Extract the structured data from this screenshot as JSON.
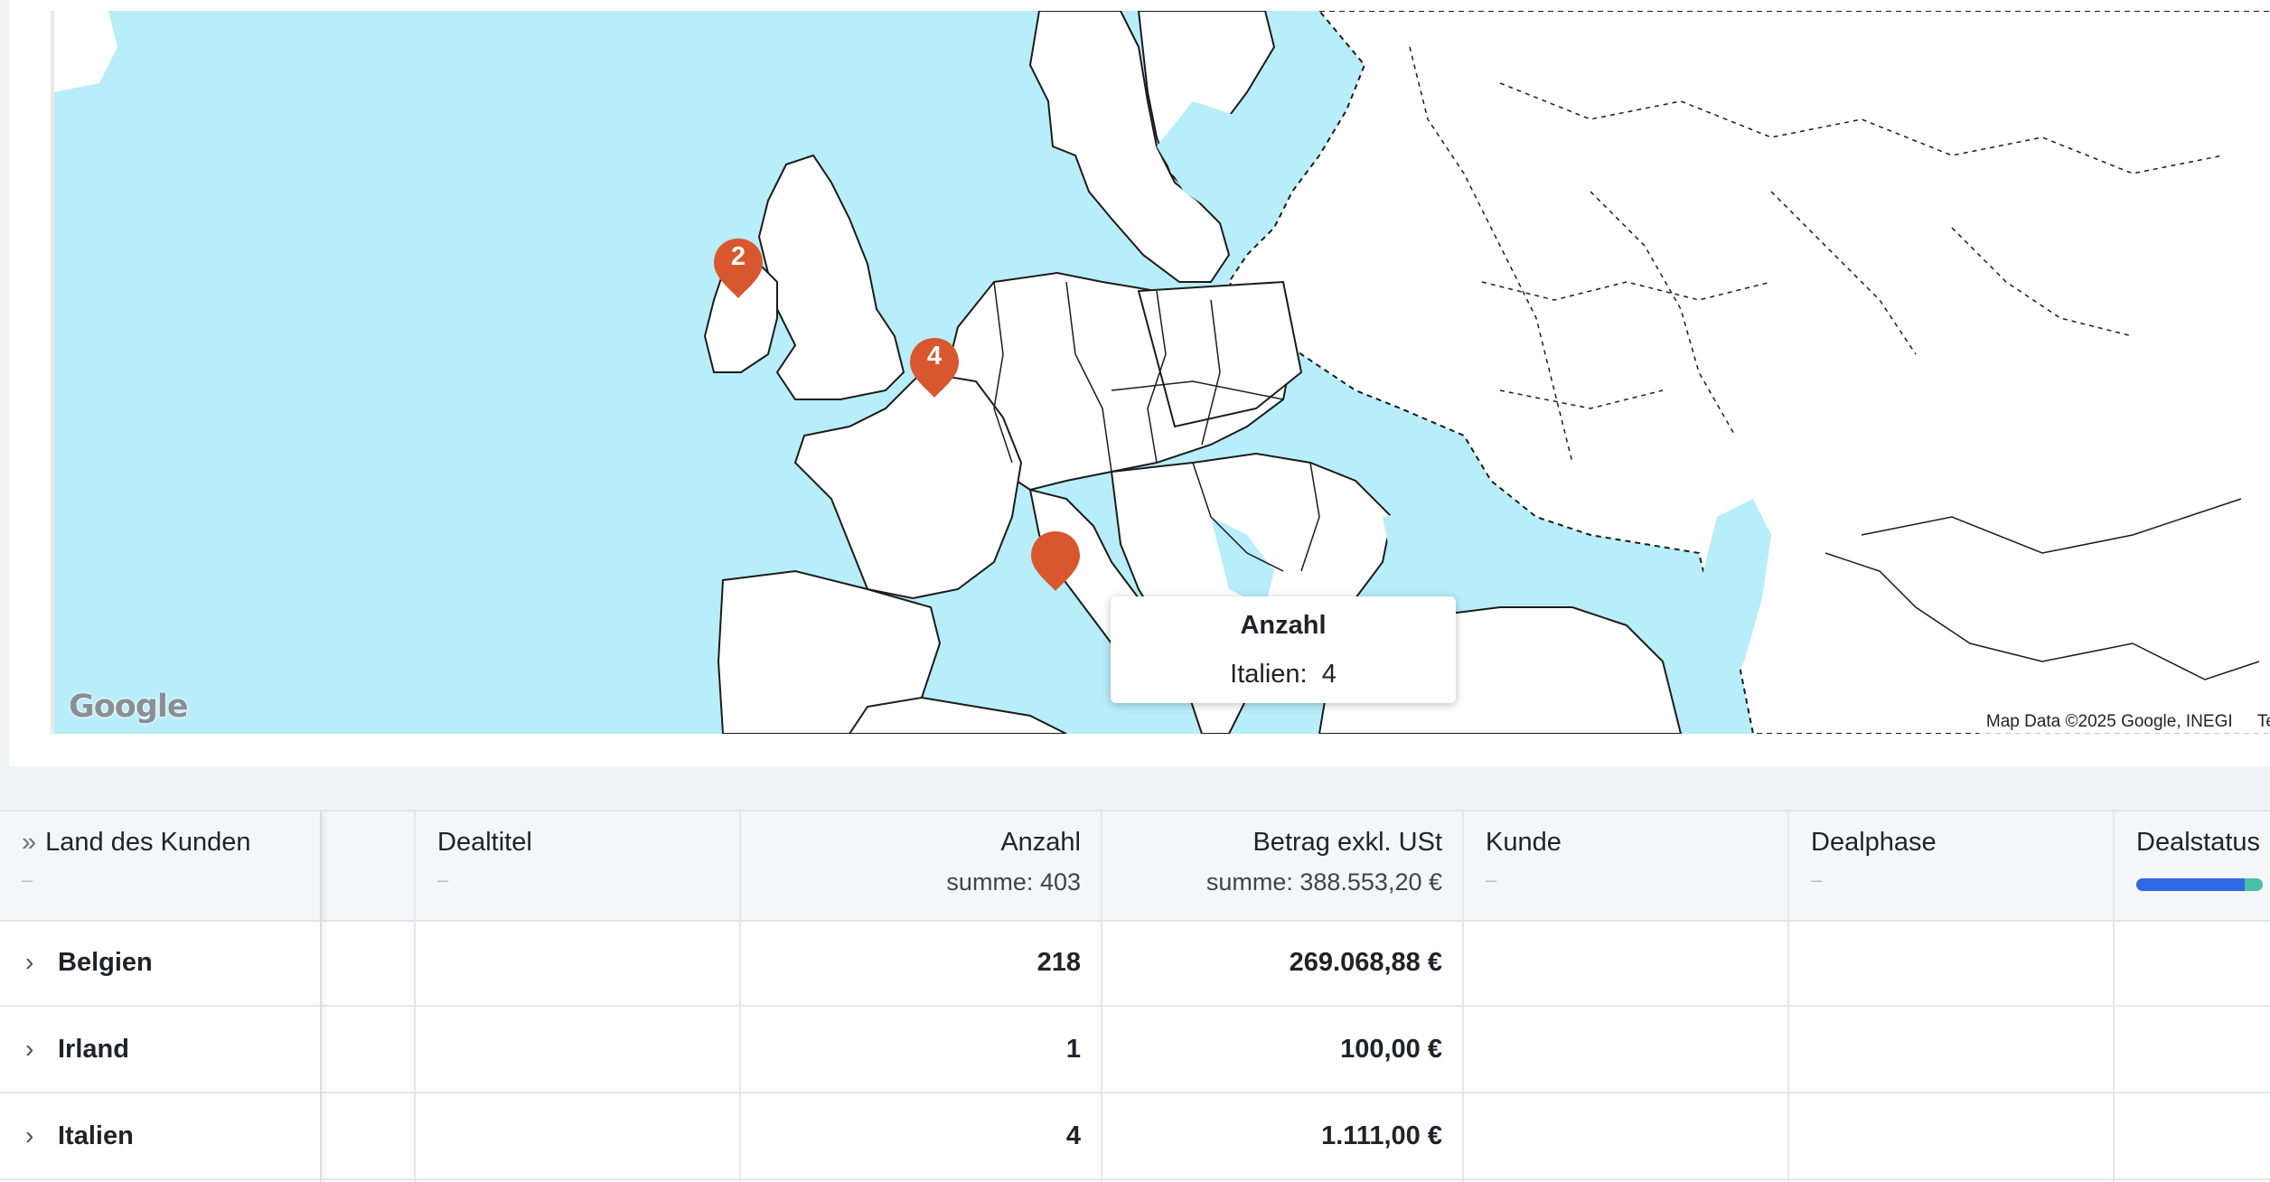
{
  "map": {
    "logo": "Google",
    "attribution": "Map Data ©2025 Google, INEGI",
    "attribution_more": "Te",
    "markers": [
      {
        "country": "Irland",
        "label": "2"
      },
      {
        "country": "Belgien",
        "label": "4"
      },
      {
        "country": "Italien",
        "label": ""
      }
    ],
    "tooltip": {
      "title": "Anzahl",
      "label": "Italien:",
      "value": "4"
    },
    "colors": {
      "water": "#b8edfa",
      "land": "#ffffff",
      "marker": "#d9572f"
    }
  },
  "table": {
    "columns": [
      {
        "label": "Land des Kunden",
        "sub": "–"
      },
      {
        "label": "",
        "sub": ""
      },
      {
        "label": "Dealtitel",
        "sub": "–"
      },
      {
        "label": "Anzahl",
        "sub": "summe: 403"
      },
      {
        "label": "Betrag exkl. USt",
        "sub": "summe: 388.553,20 €"
      },
      {
        "label": "Kunde",
        "sub": "–"
      },
      {
        "label": "Dealphase",
        "sub": "–"
      },
      {
        "label": "Dealstatus",
        "sub": ""
      }
    ],
    "rows": [
      {
        "land": "Belgien",
        "anzahl": "218",
        "betrag": "269.068,88 €"
      },
      {
        "land": "Irland",
        "anzahl": "1",
        "betrag": "100,00 €"
      },
      {
        "land": "Italien",
        "anzahl": "4",
        "betrag": "1.111,00 €"
      }
    ],
    "dealstatus_bar": {
      "won_fraction": 0.86,
      "colors": [
        "#2d6ae3",
        "#4bbfa8"
      ]
    }
  }
}
